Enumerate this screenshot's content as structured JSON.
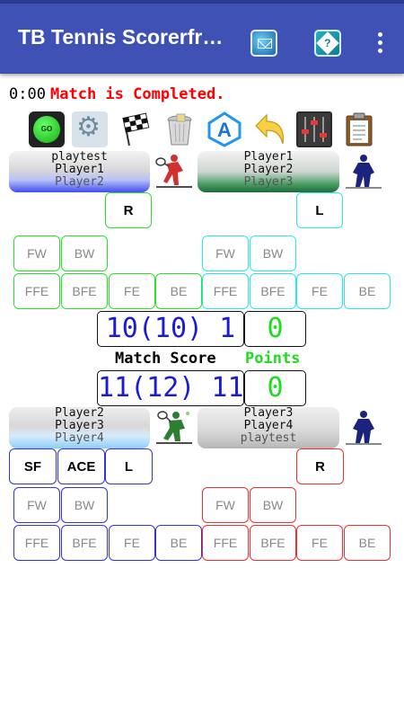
{
  "app": {
    "title": "TB Tennis Scorerfr…"
  },
  "appbar_icons": [
    "mail-icon",
    "help-icon",
    "more-vert-icon"
  ],
  "status": {
    "timer": "0:00",
    "message": "Match is Completed."
  },
  "toolbar": [
    {
      "name": "go-button",
      "label": "GO"
    },
    {
      "name": "settings-icon"
    },
    {
      "name": "checkered-flag-icon"
    },
    {
      "name": "trash-icon"
    },
    {
      "name": "font-icon",
      "label": "A"
    },
    {
      "name": "undo-icon"
    },
    {
      "name": "mixer-icon"
    },
    {
      "name": "clipboard-icon"
    }
  ],
  "players": {
    "top_left": [
      "playtest",
      "Player1",
      "Player2"
    ],
    "top_right": [
      "Player1",
      "Player2",
      "Player3"
    ],
    "bottom_left": [
      "Player2",
      "Player3",
      "Player4"
    ],
    "bottom_right": [
      "Player3",
      "Player4",
      "playtest"
    ]
  },
  "labels": {
    "R": "R",
    "L": "L",
    "SF": "SF",
    "ACE": "ACE",
    "FW": "FW",
    "BW": "BW",
    "FFE": "FFE",
    "BFE": "BFE",
    "FE": "FE",
    "BE": "BE"
  },
  "score": {
    "team_top": "10(10) 1",
    "team_top_points": "0",
    "team_bottom": "11(12) 11",
    "team_bottom_points": "0",
    "match_score_label": "Match Score",
    "points_label": "Points"
  },
  "colors": {
    "appbar": "#3f51b5",
    "status": "#ff0000",
    "score": "#1a1adc",
    "points": "#1edc1e"
  }
}
